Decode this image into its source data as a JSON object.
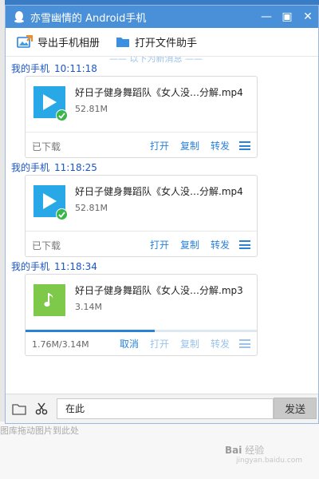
{
  "window": {
    "title": "亦雪幽情的 Android手机"
  },
  "window_controls": {
    "minimize": "—",
    "restore": "▣",
    "close": "✕"
  },
  "toolbar": {
    "export_label": "导出手机相册",
    "file_helper_label": "打开文件助手"
  },
  "cut_text": "—— 以下为新消息 ——",
  "messages": [
    {
      "sender": "我的手机",
      "time": "10:11:18",
      "file_type": "video",
      "file_name": "好日子健身舞蹈队《女人没…分解.mp4",
      "file_size": "52.81M",
      "status": "已下载",
      "actions": [
        "打开",
        "复制",
        "转发"
      ]
    },
    {
      "sender": "我的手机",
      "time": "11:18:25",
      "file_type": "video",
      "file_name": "好日子健身舞蹈队《女人没…分解.mp4",
      "file_size": "52.81M",
      "status": "已下载",
      "actions": [
        "打开",
        "复制",
        "转发"
      ]
    },
    {
      "sender": "我的手机",
      "time": "11:18:34",
      "file_type": "audio",
      "file_name": "好日子健身舞蹈队《女人没…分解.mp3",
      "file_size": "3.14M",
      "progress_text": "1.76M/3.14M",
      "progress": 0.56,
      "actions": [
        "取消",
        "打开",
        "复制",
        "转发"
      ]
    }
  ],
  "input": {
    "value": "在此"
  },
  "send_label": "发送",
  "background_hint": "图库拖动图片到此处",
  "watermark": {
    "brand": "Bai",
    "brand2": "经验",
    "sub": "jingyan.baidu.com"
  },
  "colors": {
    "titlebar": "#4a90d9",
    "accent": "#2a82d8",
    "video_thumb": "#29a8e8",
    "audio_thumb": "#7ec84a",
    "check": "#39b54a"
  }
}
